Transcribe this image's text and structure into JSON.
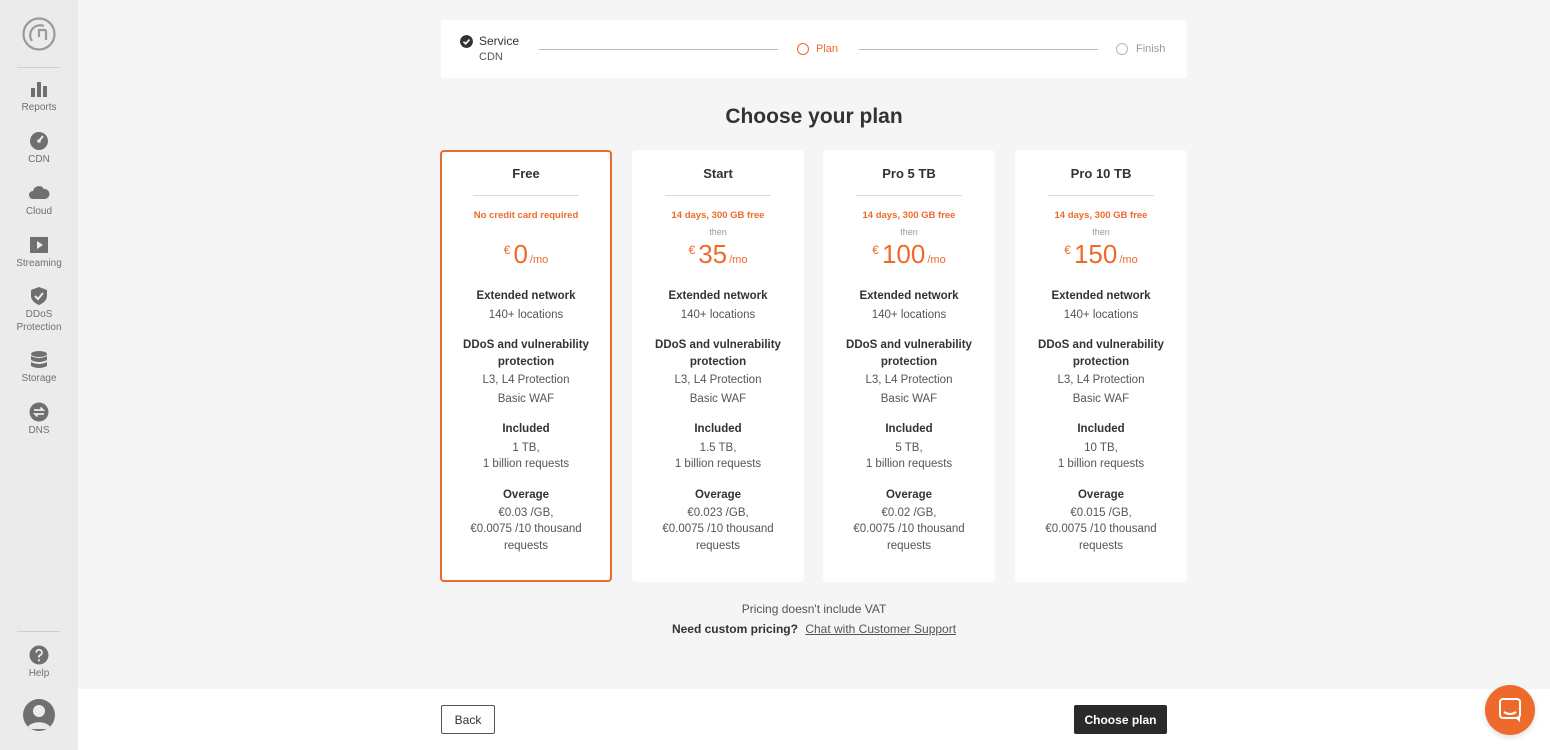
{
  "colors": {
    "accent": "#ee6a2c",
    "dark": "#2a2a2a",
    "sidebar_bg": "#ebebeb"
  },
  "sidebar": {
    "items": [
      {
        "label": "Reports",
        "icon": "bar-chart-icon"
      },
      {
        "label": "CDN",
        "icon": "speedometer-icon"
      },
      {
        "label": "Cloud",
        "icon": "cloud-icon"
      },
      {
        "label": "Streaming",
        "icon": "play-icon"
      },
      {
        "label_line1": "DDoS",
        "label_line2": "Protection",
        "icon": "shield-check-icon"
      },
      {
        "label": "Storage",
        "icon": "database-icon"
      },
      {
        "label": "DNS",
        "icon": "dns-icon"
      }
    ],
    "help": {
      "label": "Help",
      "icon": "help-icon"
    }
  },
  "stepper": {
    "step1": {
      "title": "Service",
      "subtitle": "CDN",
      "state": "done"
    },
    "step2": {
      "title": "Plan",
      "state": "active"
    },
    "step3": {
      "title": "Finish",
      "state": "pending"
    }
  },
  "title": "Choose your plan",
  "plans": [
    {
      "name": "Free",
      "selected": true,
      "promo": "No credit card required",
      "then": "",
      "currency": "€",
      "price": "0",
      "period": "/mo",
      "network_head": "Extended network",
      "network_text": "140+ locations",
      "ddos_head_1": "DDoS and vulnerability",
      "ddos_head_2": "protection",
      "ddos_text_1": "L3, L4 Protection",
      "ddos_text_2": "Basic WAF",
      "included_head": "Included",
      "included_1": "1 TB,",
      "included_2": "1 billion requests",
      "overage_head": "Overage",
      "overage_1": "€0.03 /GB,",
      "overage_2": "€0.0075 /10 thousand",
      "overage_3": "requests"
    },
    {
      "name": "Start",
      "selected": false,
      "promo": "14 days, 300 GB free",
      "then": "then",
      "currency": "€",
      "price": "35",
      "period": "/mo",
      "network_head": "Extended network",
      "network_text": "140+ locations",
      "ddos_head_1": "DDoS and vulnerability",
      "ddos_head_2": "protection",
      "ddos_text_1": "L3, L4 Protection",
      "ddos_text_2": "Basic WAF",
      "included_head": "Included",
      "included_1": "1.5 TB,",
      "included_2": "1 billion requests",
      "overage_head": "Overage",
      "overage_1": "€0.023 /GB,",
      "overage_2": "€0.0075 /10 thousand",
      "overage_3": "requests"
    },
    {
      "name": "Pro 5 TB",
      "selected": false,
      "promo": "14 days, 300 GB free",
      "then": "then",
      "currency": "€",
      "price": "100",
      "period": "/mo",
      "network_head": "Extended network",
      "network_text": "140+ locations",
      "ddos_head_1": "DDoS and vulnerability",
      "ddos_head_2": "protection",
      "ddos_text_1": "L3, L4 Protection",
      "ddos_text_2": "Basic WAF",
      "included_head": "Included",
      "included_1": "5 TB,",
      "included_2": "1 billion requests",
      "overage_head": "Overage",
      "overage_1": "€0.02 /GB,",
      "overage_2": "€0.0075 /10 thousand",
      "overage_3": "requests"
    },
    {
      "name": "Pro 10 TB",
      "selected": false,
      "promo": "14 days, 300 GB free",
      "then": "then",
      "currency": "€",
      "price": "150",
      "period": "/mo",
      "network_head": "Extended network",
      "network_text": "140+ locations",
      "ddos_head_1": "DDoS and vulnerability",
      "ddos_head_2": "protection",
      "ddos_text_1": "L3, L4 Protection",
      "ddos_text_2": "Basic WAF",
      "included_head": "Included",
      "included_1": "10 TB,",
      "included_2": "1 billion requests",
      "overage_head": "Overage",
      "overage_1": "€0.015 /GB,",
      "overage_2": "€0.0075 /10 thousand",
      "overage_3": "requests"
    }
  ],
  "vat_note": "Pricing doesn't include VAT",
  "custom_pricing": {
    "question": "Need custom pricing?",
    "link": "Chat with Customer Support"
  },
  "footer": {
    "back": "Back",
    "choose": "Choose plan"
  },
  "chat": {
    "icon": "chat-icon"
  }
}
